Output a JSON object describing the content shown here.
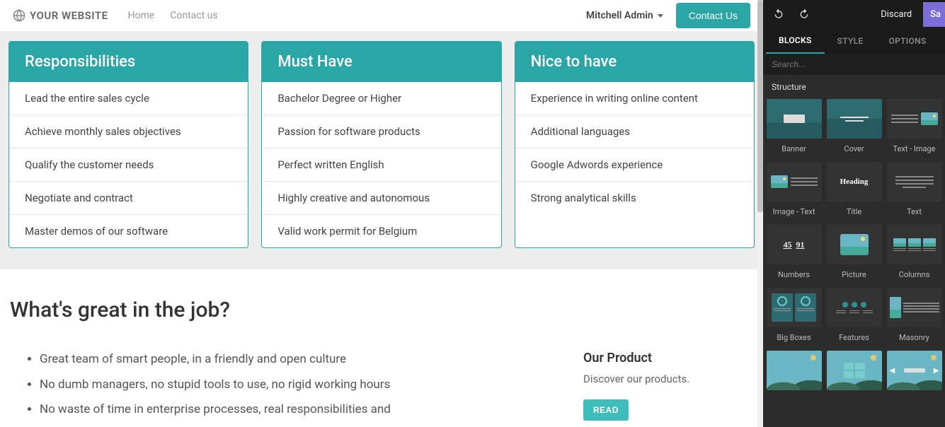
{
  "nav": {
    "logo_text": "YOUR WEBSITE",
    "links": [
      "Home",
      "Contact us"
    ],
    "user": "Mitchell Admin",
    "contact_btn": "Contact Us"
  },
  "cards": [
    {
      "title": "Responsibilities",
      "items": [
        "Lead the entire sales cycle",
        "Achieve monthly sales objectives",
        "Qualify the customer needs",
        "Negotiate and contract",
        "Master demos of our software"
      ]
    },
    {
      "title": "Must Have",
      "items": [
        "Bachelor Degree or Higher",
        "Passion for software products",
        "Perfect written English",
        "Highly creative and autonomous",
        "Valid work permit for Belgium"
      ]
    },
    {
      "title": "Nice to have",
      "items": [
        "Experience in writing online content",
        "Additional languages",
        "Google Adwords experience",
        "Strong analytical skills"
      ]
    }
  ],
  "great": {
    "title": "What's great in the job?",
    "bullets": [
      "Great team of smart people, in a friendly and open culture",
      "No dumb managers, no stupid tools to use, no rigid working hours",
      "No waste of time in enterprise processes, real responsibilities and"
    ],
    "product": {
      "title": "Our Product",
      "desc": "Discover our products.",
      "btn": "READ"
    }
  },
  "editor": {
    "discard": "Discard",
    "save": "Sa",
    "tabs": [
      "BLOCKS",
      "STYLE",
      "OPTIONS"
    ],
    "search_placeholder": "Search...",
    "section_label": "Structure",
    "blocks": [
      "Banner",
      "Cover",
      "Text - Image",
      "Image - Text",
      "Title",
      "Text",
      "Numbers",
      "Picture",
      "Columns",
      "Big Boxes",
      "Features",
      "Masonry",
      "",
      "",
      ""
    ],
    "title_thumb_text": "Heading",
    "numbers_thumb": [
      "45",
      "91"
    ]
  }
}
